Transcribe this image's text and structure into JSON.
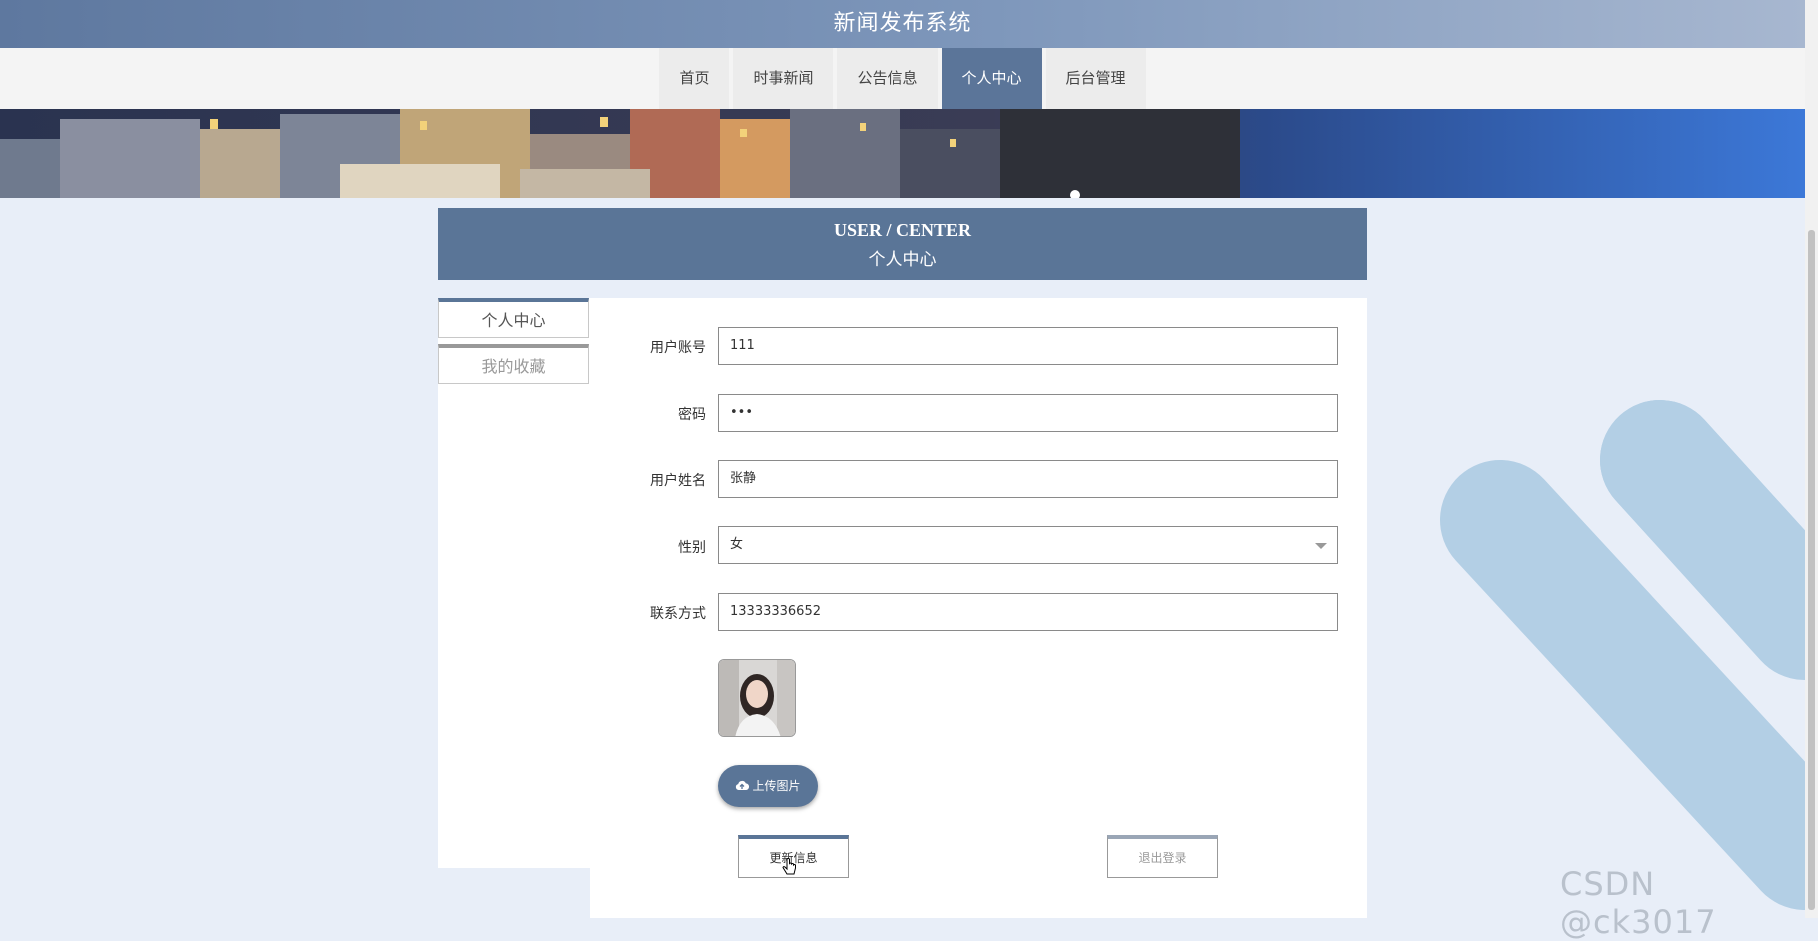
{
  "header": {
    "title": "新闻发布系统"
  },
  "nav": {
    "items": [
      {
        "label": "首页"
      },
      {
        "label": "时事新闻"
      },
      {
        "label": "公告信息"
      },
      {
        "label": "个人中心",
        "active": true
      },
      {
        "label": "后台管理"
      }
    ]
  },
  "page_header": {
    "en": "USER / CENTER",
    "cn": "个人中心"
  },
  "sidebar": {
    "items": [
      {
        "label": "个人中心",
        "active": true
      },
      {
        "label": "我的收藏"
      }
    ]
  },
  "form": {
    "account": {
      "label": "用户账号",
      "value": "111"
    },
    "password": {
      "label": "密码",
      "value": "•••"
    },
    "name": {
      "label": "用户姓名",
      "value": "张静"
    },
    "gender": {
      "label": "性别",
      "value": "女"
    },
    "contact": {
      "label": "联系方式",
      "value": "13333336652"
    },
    "upload_label": "上传图片",
    "update_label": "更新信息",
    "logout_label": "退出登录"
  },
  "watermark": "CSDN @ck3017",
  "colors": {
    "primary": "#5a7597",
    "background": "#e8eef8",
    "stripe": "#b3cfe5"
  }
}
